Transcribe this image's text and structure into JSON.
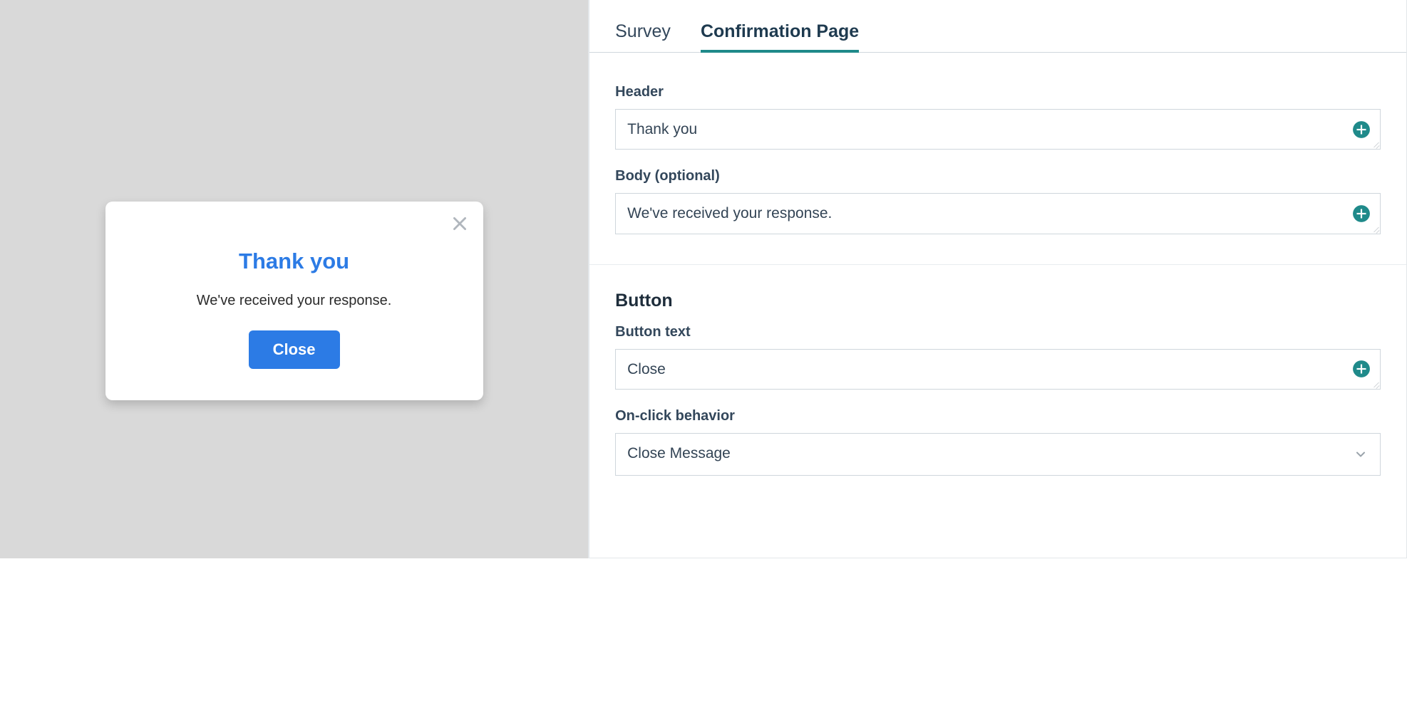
{
  "tabs": {
    "survey": "Survey",
    "confirmation": "Confirmation Page",
    "active": "confirmation"
  },
  "fields": {
    "header": {
      "label": "Header",
      "value": "Thank you"
    },
    "body": {
      "label": "Body (optional)",
      "value": "We've received your response."
    }
  },
  "buttonSection": {
    "title": "Button",
    "text": {
      "label": "Button text",
      "value": "Close"
    },
    "behavior": {
      "label": "On-click behavior",
      "value": "Close Message"
    }
  },
  "preview": {
    "title": "Thank you",
    "body": "We've received your response.",
    "button": "Close"
  },
  "colors": {
    "accentBlue": "#2c7be5",
    "teal": "#1f8a8a",
    "text": "#33475b"
  }
}
